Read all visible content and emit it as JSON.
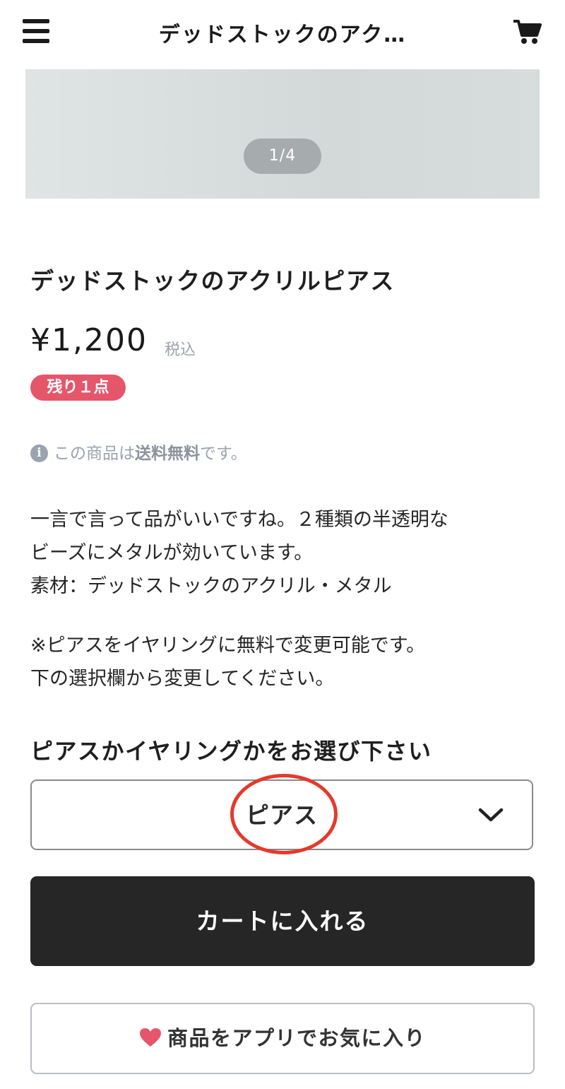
{
  "header": {
    "title": "デッドストックのアク…",
    "menu_icon": "hamburger-menu-icon",
    "cart_icon": "shopping-cart-icon"
  },
  "gallery": {
    "counter": "1/4"
  },
  "product": {
    "title": "デッドストックのアクリルピアス",
    "price": "¥1,200",
    "tax_note": "税込",
    "stock_badge": "残り１点"
  },
  "shipping": {
    "icon": "info-icon",
    "prefix": "この商品は",
    "highlight": "送料無料",
    "suffix": "です。"
  },
  "description": {
    "line1": "一言で言って品がいいですね。２種類の半透明な",
    "line2": "ビーズにメタルが効いています。",
    "line3": "素材：デッドストックのアクリル・メタル",
    "line4": "※ピアスをイヤリングに無料で変更可能です。",
    "line5": "下の選択欄から変更してください。"
  },
  "option": {
    "label": "ピアスかイヤリングかをお選び下さい",
    "selected": "ピアス",
    "chevron_icon": "chevron-down-icon"
  },
  "actions": {
    "add_to_cart": "カートに入れる",
    "favorite": "商品をアプリでお気に入り",
    "favorite_icon": "heart-icon"
  },
  "colors": {
    "badge": "#e6566b",
    "primary_button": "#262626",
    "highlight_circle": "#e43a2a",
    "heart": "#e6566b",
    "muted_text": "#9aa3ae"
  }
}
